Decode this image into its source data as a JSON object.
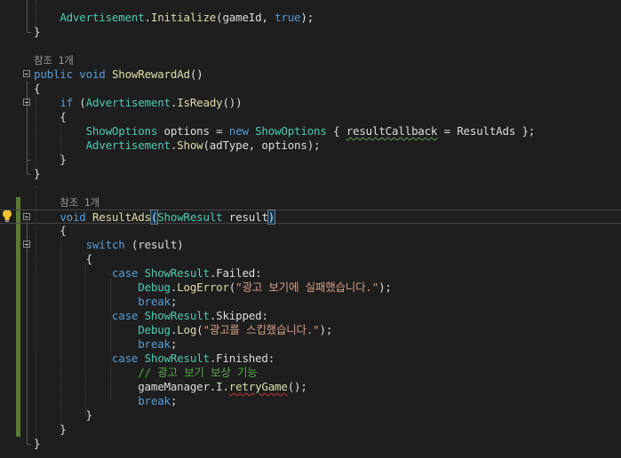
{
  "theme": {
    "background": "#1e1e1e",
    "keyword": "#569cd6",
    "type": "#4ec9b0",
    "method": "#dcdcaa",
    "text": "#dcdcdc",
    "string": "#d69d85",
    "comment": "#57a64a",
    "codelens": "#999999",
    "change_bar": "#5b7a34"
  },
  "icons": {
    "lightbulb": "lightbulb-icon"
  },
  "lines": [
    {
      "tokens": [
        [
          "    ",
          ""
        ],
        [
          "Advertisement",
          "type"
        ],
        [
          ".",
          "text"
        ],
        [
          "Initialize",
          "method"
        ],
        [
          "(gameId, ",
          "text"
        ],
        [
          "true",
          "keyword"
        ],
        [
          ");",
          "text"
        ]
      ]
    },
    {
      "tokens": [
        [
          "}",
          "text"
        ]
      ]
    },
    {
      "tokens": [
        [
          "",
          "text"
        ]
      ]
    },
    {
      "tokens": [
        [
          "참조 1개",
          "codelens"
        ]
      ]
    },
    {
      "tokens": [
        [
          "public",
          "keyword"
        ],
        [
          " ",
          "text"
        ],
        [
          "void",
          "keyword"
        ],
        [
          " ",
          "text"
        ],
        [
          "ShowRewardAd",
          "method"
        ],
        [
          "()",
          "text"
        ]
      ]
    },
    {
      "tokens": [
        [
          "{",
          "text"
        ]
      ]
    },
    {
      "tokens": [
        [
          "    ",
          ""
        ],
        [
          "if",
          "keyword"
        ],
        [
          " (",
          "text"
        ],
        [
          "Advertisement",
          "type"
        ],
        [
          ".",
          "text"
        ],
        [
          "IsReady",
          "method"
        ],
        [
          "())",
          "text"
        ]
      ]
    },
    {
      "tokens": [
        [
          "    {",
          "text"
        ]
      ]
    },
    {
      "tokens": [
        [
          "        ",
          ""
        ],
        [
          "ShowOptions",
          "type"
        ],
        [
          " options = ",
          "text"
        ],
        [
          "new",
          "keyword"
        ],
        [
          " ",
          "text"
        ],
        [
          "ShowOptions",
          "type"
        ],
        [
          " { ",
          "text"
        ],
        [
          "resultCallback",
          "text-squiggle-g"
        ],
        [
          " = ResultAds };",
          "text"
        ]
      ]
    },
    {
      "tokens": [
        [
          "        ",
          ""
        ],
        [
          "Advertisement",
          "type"
        ],
        [
          ".",
          "text"
        ],
        [
          "Show",
          "method"
        ],
        [
          "(adType, options);",
          "text"
        ]
      ]
    },
    {
      "tokens": [
        [
          "    }",
          "text"
        ]
      ]
    },
    {
      "tokens": [
        [
          "}",
          "text"
        ]
      ]
    },
    {
      "tokens": [
        [
          "",
          "text"
        ]
      ]
    },
    {
      "tokens": [
        [
          "    ",
          ""
        ],
        [
          "참조 1개",
          "codelens"
        ]
      ]
    },
    {
      "tokens": [
        [
          "    ",
          ""
        ],
        [
          "void",
          "keyword"
        ],
        [
          " ",
          "text"
        ],
        [
          "ResultAds",
          "method"
        ],
        [
          "(",
          "paren"
        ],
        [
          "ShowResult",
          "type"
        ],
        [
          " result",
          "text"
        ],
        [
          ")",
          "paren"
        ]
      ]
    },
    {
      "tokens": [
        [
          "    {",
          "text"
        ]
      ]
    },
    {
      "tokens": [
        [
          "        ",
          ""
        ],
        [
          "switch",
          "keyword"
        ],
        [
          " (result)",
          "text"
        ]
      ]
    },
    {
      "tokens": [
        [
          "        {",
          "text"
        ]
      ]
    },
    {
      "tokens": [
        [
          "            ",
          ""
        ],
        [
          "case",
          "keyword"
        ],
        [
          " ",
          "text"
        ],
        [
          "ShowResult",
          "type"
        ],
        [
          ".Failed:",
          "text"
        ]
      ]
    },
    {
      "tokens": [
        [
          "                ",
          ""
        ],
        [
          "Debug",
          "type"
        ],
        [
          ".",
          "text"
        ],
        [
          "LogError",
          "method"
        ],
        [
          "(",
          "text"
        ],
        [
          "\"광고 보기에 실패했습니다.\"",
          "string"
        ],
        [
          ");",
          "text"
        ]
      ]
    },
    {
      "tokens": [
        [
          "                ",
          ""
        ],
        [
          "break",
          "keyword"
        ],
        [
          ";",
          "text"
        ]
      ]
    },
    {
      "tokens": [
        [
          "            ",
          ""
        ],
        [
          "case",
          "keyword"
        ],
        [
          " ",
          "text"
        ],
        [
          "ShowResult",
          "type"
        ],
        [
          ".Skipped:",
          "text"
        ]
      ]
    },
    {
      "tokens": [
        [
          "                ",
          ""
        ],
        [
          "Debug",
          "type"
        ],
        [
          ".",
          "text"
        ],
        [
          "Log",
          "method"
        ],
        [
          "(",
          "text"
        ],
        [
          "\"광고를 스킵했습니다.\"",
          "string"
        ],
        [
          ");",
          "text"
        ]
      ]
    },
    {
      "tokens": [
        [
          "                ",
          ""
        ],
        [
          "break",
          "keyword"
        ],
        [
          ";",
          "text"
        ]
      ]
    },
    {
      "tokens": [
        [
          "            ",
          ""
        ],
        [
          "case",
          "keyword"
        ],
        [
          " ",
          "text"
        ],
        [
          "ShowResult",
          "type"
        ],
        [
          ".Finished:",
          "text"
        ]
      ]
    },
    {
      "tokens": [
        [
          "                ",
          ""
        ],
        [
          "// 광고 보기 보상 기능",
          "comment"
        ]
      ]
    },
    {
      "tokens": [
        [
          "                ",
          ""
        ],
        [
          "gameManager.I.",
          "text"
        ],
        [
          "retryGame",
          "method-squiggle"
        ],
        [
          "();",
          "text"
        ]
      ]
    },
    {
      "tokens": [
        [
          "                ",
          ""
        ],
        [
          "break",
          "keyword"
        ],
        [
          ";",
          "text"
        ]
      ]
    },
    {
      "tokens": [
        [
          "        }",
          "text"
        ]
      ]
    },
    {
      "tokens": [
        [
          "    }",
          "text"
        ]
      ]
    },
    {
      "tokens": [
        [
          "}",
          "text"
        ]
      ]
    }
  ]
}
